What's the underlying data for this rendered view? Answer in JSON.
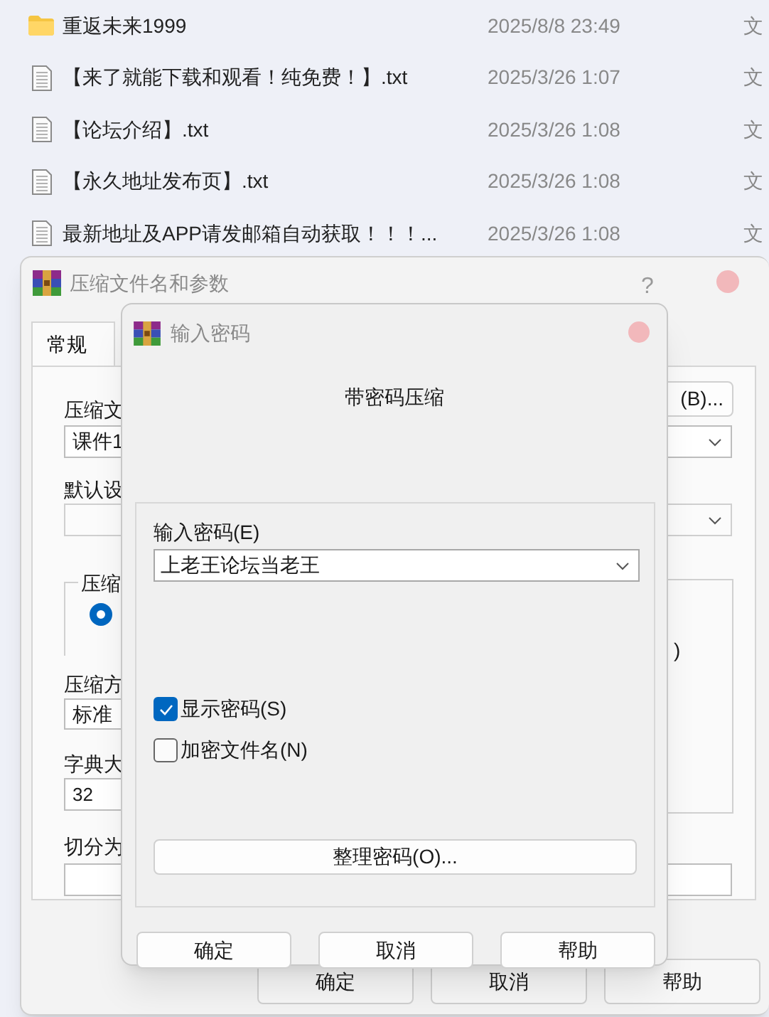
{
  "file_list": {
    "rows": [
      {
        "kind": "folder",
        "name": "重返未来1999",
        "date": "2025/8/8 23:49",
        "type": "文"
      },
      {
        "kind": "text_file",
        "name": "【来了就能下载和观看！纯免费！】.txt",
        "date": "2025/3/26 1:07",
        "type": "文"
      },
      {
        "kind": "text_file",
        "name": "【论坛介绍】.txt",
        "date": "2025/3/26 1:08",
        "type": "文"
      },
      {
        "kind": "text_file",
        "name": "【永久地址发布页】.txt",
        "date": "2025/3/26 1:08",
        "type": "文"
      },
      {
        "kind": "text_file",
        "name": "最新地址及APP请发邮箱自动获取！！！...",
        "date": "2025/3/26 1:08",
        "type": "文"
      }
    ]
  },
  "archive_dialog": {
    "title": "压缩文件名和参数",
    "help": "?",
    "tabs": [
      {
        "label": "常规",
        "selected": true
      }
    ],
    "browse_button": "(B)...",
    "archive_name_label": "压缩文",
    "archive_name": "课件1",
    "profile_label": "默认设",
    "format_group_label": "压缩",
    "format_radio_selected": true,
    "format_fragment": ")",
    "method_label": "压缩方",
    "method": "标准",
    "dictionary_label": "字典大",
    "dictionary": "32",
    "split_label": "切分为",
    "buttons": [
      "确定",
      "取消",
      "帮助"
    ]
  },
  "password_dialog": {
    "title": "输入密码",
    "heading": "带密码压缩",
    "password_label": "输入密码(E)",
    "password": "上老王论坛当老王",
    "checkboxes": [
      {
        "label": "显示密码(S)",
        "checked": true
      },
      {
        "label": "加密文件名(N)",
        "checked": false
      }
    ],
    "organize_button": "整理密码(O)...",
    "buttons": [
      "确定",
      "取消",
      "帮助"
    ]
  }
}
